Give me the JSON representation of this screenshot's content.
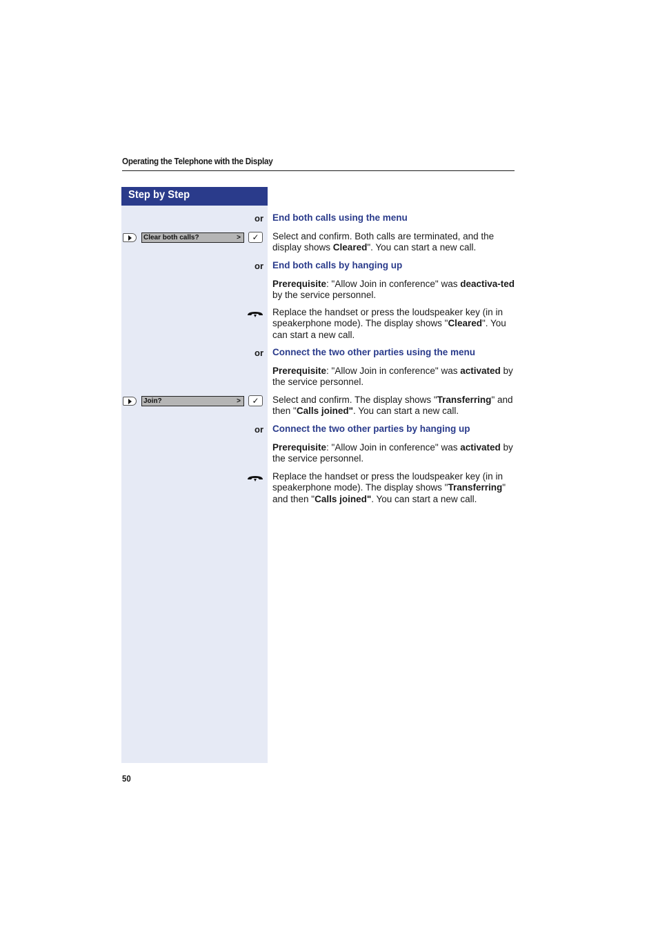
{
  "header": {
    "title": "Operating the Telephone with the Display"
  },
  "sidebar": {
    "title": "Step by Step"
  },
  "sections": [
    {
      "or_label": "or",
      "heading": "End both calls using the menu",
      "display_text": "Clear both calls?",
      "display_arrow": ">",
      "check_glyph": "✓",
      "text_parts": [
        "Select and confirm. Both calls are terminated, and the display shows ",
        "Cleared",
        "\". You can start a new call."
      ]
    },
    {
      "or_label": "or",
      "heading": "End both calls by hanging up",
      "prereq": [
        "Prerequisite",
        ": \"Allow Join in conference\" was ",
        "deactiva-ted",
        " by the service personnel."
      ],
      "text_parts": [
        "Replace the handset or press the loudspeaker key (in in speakerphone mode). The display shows \"",
        "Cleared",
        "\". You can start a new call."
      ]
    },
    {
      "or_label": "or",
      "heading": "Connect the two other parties using the menu",
      "prereq": [
        "Prerequisite",
        ": \"Allow Join in conference\" was ",
        "activated",
        " by the service personnel."
      ],
      "display_text": "Join?",
      "display_arrow": ">",
      "check_glyph": "✓",
      "text_parts": [
        "Select and confirm. The display shows \"",
        "Transferring",
        "\" and then \"",
        "Calls joined\"",
        ". You can start a new call."
      ]
    },
    {
      "or_label": "or",
      "heading": "Connect the two other parties by hanging up",
      "prereq": [
        "Prerequisite",
        ": \"Allow Join in conference\" was ",
        "activated",
        " by the service personnel."
      ],
      "text_parts": [
        "Replace the handset or press the loudspeaker key (in in speakerphone mode). The display shows \"",
        "Transferring",
        "\" and then \"",
        "Calls joined\"",
        ". You can start a new call."
      ]
    }
  ],
  "footer": {
    "page_number": "50"
  },
  "colors": {
    "accent": "#2a3b8b",
    "sidebar_bg": "#e6eaf5",
    "display_bg": "#b5b5b5"
  }
}
